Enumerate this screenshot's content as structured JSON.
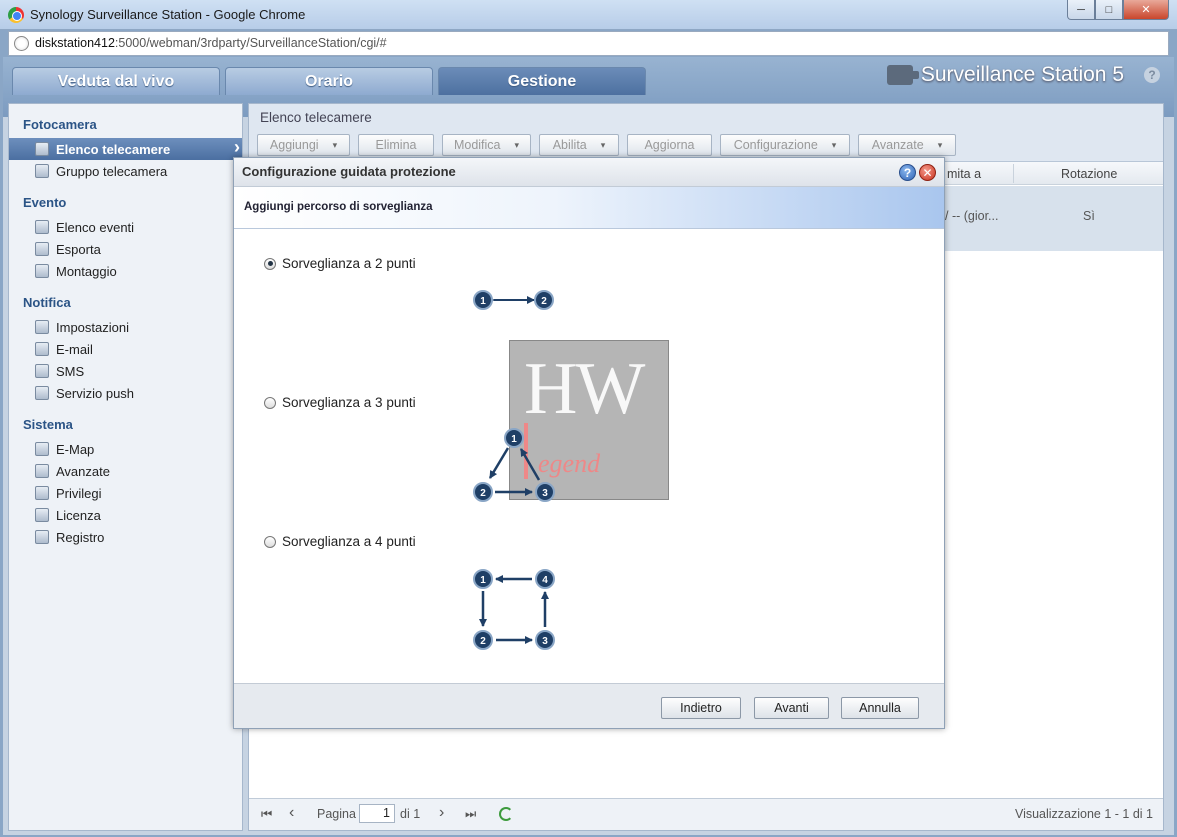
{
  "window": {
    "title": "Synology Surveillance Station - Google Chrome",
    "url_host": "diskstation412",
    "url_rest": ":5000/webman/3rdparty/SurveillanceStation/cgi/#",
    "min": "─",
    "max": "□",
    "close": "✕"
  },
  "tabs": [
    {
      "label": "Veduta dal vivo"
    },
    {
      "label": "Orario"
    },
    {
      "label": "Gestione"
    }
  ],
  "brand": {
    "name": "Surveillance Station 5",
    "help": "?"
  },
  "sidebar": {
    "groups": [
      {
        "label": "Fotocamera",
        "items": [
          {
            "label": "Elenco telecamere"
          },
          {
            "label": "Gruppo telecamera"
          }
        ]
      },
      {
        "label": "Evento",
        "items": [
          {
            "label": "Elenco eventi"
          },
          {
            "label": "Esporta"
          },
          {
            "label": "Montaggio"
          }
        ]
      },
      {
        "label": "Notifica",
        "items": [
          {
            "label": "Impostazioni"
          },
          {
            "label": "E-mail"
          },
          {
            "label": "SMS"
          },
          {
            "label": "Servizio push"
          }
        ]
      },
      {
        "label": "Sistema",
        "items": [
          {
            "label": "E-Map"
          },
          {
            "label": "Avanzate"
          },
          {
            "label": "Privilegi"
          },
          {
            "label": "Licenza"
          },
          {
            "label": "Registro"
          }
        ]
      }
    ]
  },
  "main": {
    "title": "Elenco telecamere",
    "toolbar": {
      "add": "Aggiungi",
      "delete": "Elimina",
      "edit": "Modifica",
      "enable": "Abilita",
      "refresh": "Aggiorna",
      "config": "Configurazione",
      "advanced": "Avanzate"
    },
    "columns": {
      "limit": "mita a",
      "rotation": "Rotazione"
    },
    "row": {
      "limit": "/ -- (gior...",
      "rotation": "Sì"
    },
    "pager": {
      "page_label": "Pagina",
      "page_value": "1",
      "of_label": "di 1",
      "status": "Visualizzazione 1 - 1 di 1",
      "first": "⏮",
      "prev": "‹",
      "next": "›",
      "last": "⏭"
    }
  },
  "dialog": {
    "title": "Configurazione guidata protezione",
    "help": "?",
    "close": "✕",
    "subtitle": "Aggiungi percorso di sorveglianza",
    "options": [
      {
        "label": "Sorveglianza a 2 punti",
        "checked": true
      },
      {
        "label": "Sorveglianza a 3 punti",
        "checked": false
      },
      {
        "label": "Sorveglianza a 4 punti",
        "checked": false
      }
    ],
    "badges": [
      "1",
      "2",
      "3",
      "4"
    ],
    "watermark": {
      "hw": "HW",
      "legend": "egend"
    },
    "buttons": {
      "back": "Indietro",
      "next": "Avanti",
      "cancel": "Annulla"
    }
  },
  "colors": {
    "badge_fill": "#1f3f66",
    "accent": "#2b5486"
  }
}
